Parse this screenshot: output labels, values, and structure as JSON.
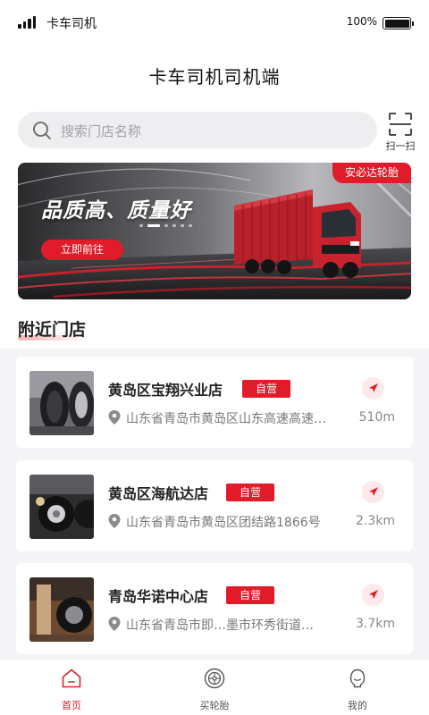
{
  "status_bar": {
    "carrier": "卡车司机",
    "battery_percent": "100%"
  },
  "header": {
    "title": "卡车司机司机端"
  },
  "search": {
    "placeholder": "搜索门店名称",
    "scan_label": "扫一扫"
  },
  "banner": {
    "headline": "品质高、质量好",
    "cta_label": "立即前往",
    "tag_label": "安必达轮胎",
    "accent_color": "#e21b2a",
    "slide_count": 6,
    "active_slide": 2
  },
  "nearby": {
    "section_title": "附近门店",
    "stores": [
      {
        "name": "黄岛区宝翔兴业店",
        "badge": "自营",
        "address": "山东省青岛市黄岛区山东高速高速…",
        "distance": "510m"
      },
      {
        "name": "黄岛区海航达店",
        "badge": "自营",
        "address": "山东省青岛市黄岛区团结路1866号",
        "distance": "2.3km"
      },
      {
        "name": "青岛华诺中心店",
        "badge": "自营",
        "address": "山东省青岛市即…墨市环秀街道…",
        "distance": "3.7km"
      }
    ]
  },
  "tab_bar": {
    "active_color": "#d2232a",
    "items": [
      {
        "label": "首页",
        "icon": "home-icon",
        "active": true
      },
      {
        "label": "买轮胎",
        "icon": "tire-icon",
        "active": false
      },
      {
        "label": "我的",
        "icon": "profile-icon",
        "active": false
      }
    ]
  }
}
